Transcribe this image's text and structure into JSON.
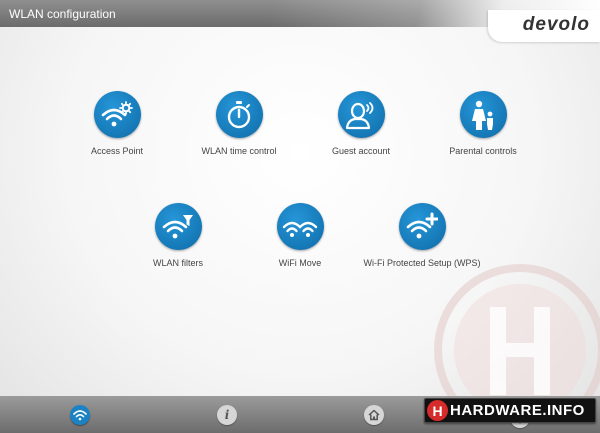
{
  "window": {
    "title": "WLAN configuration"
  },
  "brand": {
    "logo_text": "devolo",
    "accent_color": "#1678b6"
  },
  "tiles": [
    {
      "label": "Access Point",
      "icon": "wifi-gear-icon"
    },
    {
      "label": "WLAN time control",
      "icon": "stopwatch-icon"
    },
    {
      "label": "Guest account",
      "icon": "guest-user-icon"
    },
    {
      "label": "Parental controls",
      "icon": "parent-child-icon"
    },
    {
      "label": "WLAN filters",
      "icon": "wifi-filter-icon"
    },
    {
      "label": "WiFi Move",
      "icon": "wifi-move-icon"
    },
    {
      "label": "Wi-Fi Protected Setup (WPS)",
      "icon": "wifi-plus-icon"
    }
  ],
  "bottom_nav": [
    {
      "icon": "wifi-icon",
      "active": true
    },
    {
      "icon": "info-icon",
      "glyph": "i"
    },
    {
      "icon": "home-icon"
    },
    {
      "icon": "gear-icon"
    }
  ],
  "watermark": {
    "badge_text": "HARDWARE.INFO",
    "badge_glyph": "H"
  }
}
